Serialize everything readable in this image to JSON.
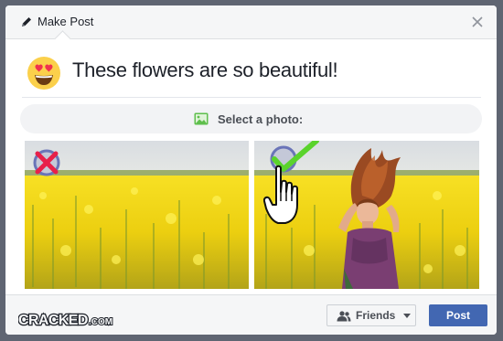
{
  "header": {
    "title": "Make Post",
    "icon": "pencil-icon",
    "close_icon": "close-icon"
  },
  "post": {
    "text": "These flowers are so beautiful!",
    "emoji": "heart-eyes-emoji-icon"
  },
  "photo_selector": {
    "label": "Select a photo:",
    "icon": "photo-icon",
    "options": [
      {
        "name": "empty-flower-field",
        "state": "rejected",
        "mark": "red-x-icon"
      },
      {
        "name": "woman-in-flower-field",
        "state": "selected",
        "mark": "green-check-icon",
        "cursor": "hand-pointer-icon"
      }
    ]
  },
  "footer": {
    "logo_text": "CRACKED.COM",
    "audience_label": "Friends",
    "audience_icon": "friends-icon",
    "post_label": "Post"
  },
  "colors": {
    "accent": "#4267b2",
    "check": "#5ad32c",
    "cross": "#e8204a",
    "field": "#f3d218"
  }
}
